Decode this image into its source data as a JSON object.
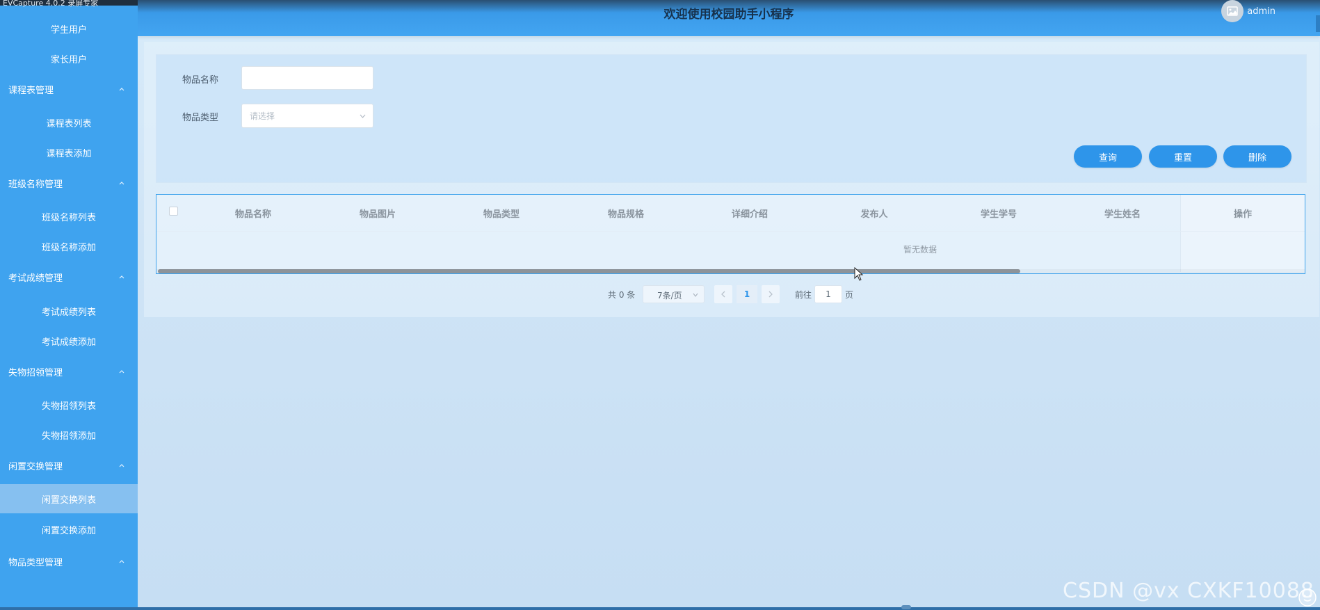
{
  "capture_label": "EVCapture 4.0.2 录屏专家",
  "header": {
    "title": "欢迎使用校园助手小程序",
    "user": "admin"
  },
  "sidebar": {
    "items": [
      {
        "type": "item",
        "label": "学生用户"
      },
      {
        "type": "item",
        "label": "家长用户"
      },
      {
        "type": "group",
        "label": "课程表管理"
      },
      {
        "type": "item",
        "label": "课程表列表"
      },
      {
        "type": "item",
        "label": "课程表添加"
      },
      {
        "type": "group",
        "label": "班级名称管理"
      },
      {
        "type": "item",
        "label": "班级名称列表"
      },
      {
        "type": "item",
        "label": "班级名称添加"
      },
      {
        "type": "group",
        "label": "考试成绩管理"
      },
      {
        "type": "item",
        "label": "考试成绩列表"
      },
      {
        "type": "item",
        "label": "考试成绩添加"
      },
      {
        "type": "group",
        "label": "失物招领管理"
      },
      {
        "type": "item",
        "label": "失物招领列表"
      },
      {
        "type": "item",
        "label": "失物招领添加"
      },
      {
        "type": "group",
        "label": "闲置交换管理"
      },
      {
        "type": "item",
        "label": "闲置交换列表",
        "active": true
      },
      {
        "type": "item",
        "label": "闲置交换添加"
      },
      {
        "type": "group",
        "label": "物品类型管理"
      }
    ]
  },
  "search": {
    "name_label": "物品名称",
    "name_value": "",
    "type_label": "物品类型",
    "type_placeholder": "请选择",
    "buttons": {
      "query": "查询",
      "reset": "重置",
      "delete": "删除"
    }
  },
  "table": {
    "columns": [
      "物品名称",
      "物品图片",
      "物品类型",
      "物品规格",
      "详细介绍",
      "发布人",
      "学生学号",
      "学生姓名",
      "操作"
    ],
    "empty_text": "暂无数据"
  },
  "pagination": {
    "total_text": "共 0 条",
    "page_size": "7条/页",
    "current_page": "1",
    "goto_label": "前往",
    "goto_value": "1",
    "page_suffix": "页"
  },
  "watermark": "CSDN @vx CXKF10088",
  "colors": {
    "sidebar": "#3fa3ef",
    "primary": "#2e95ea",
    "active_item": "#86c0f0"
  }
}
